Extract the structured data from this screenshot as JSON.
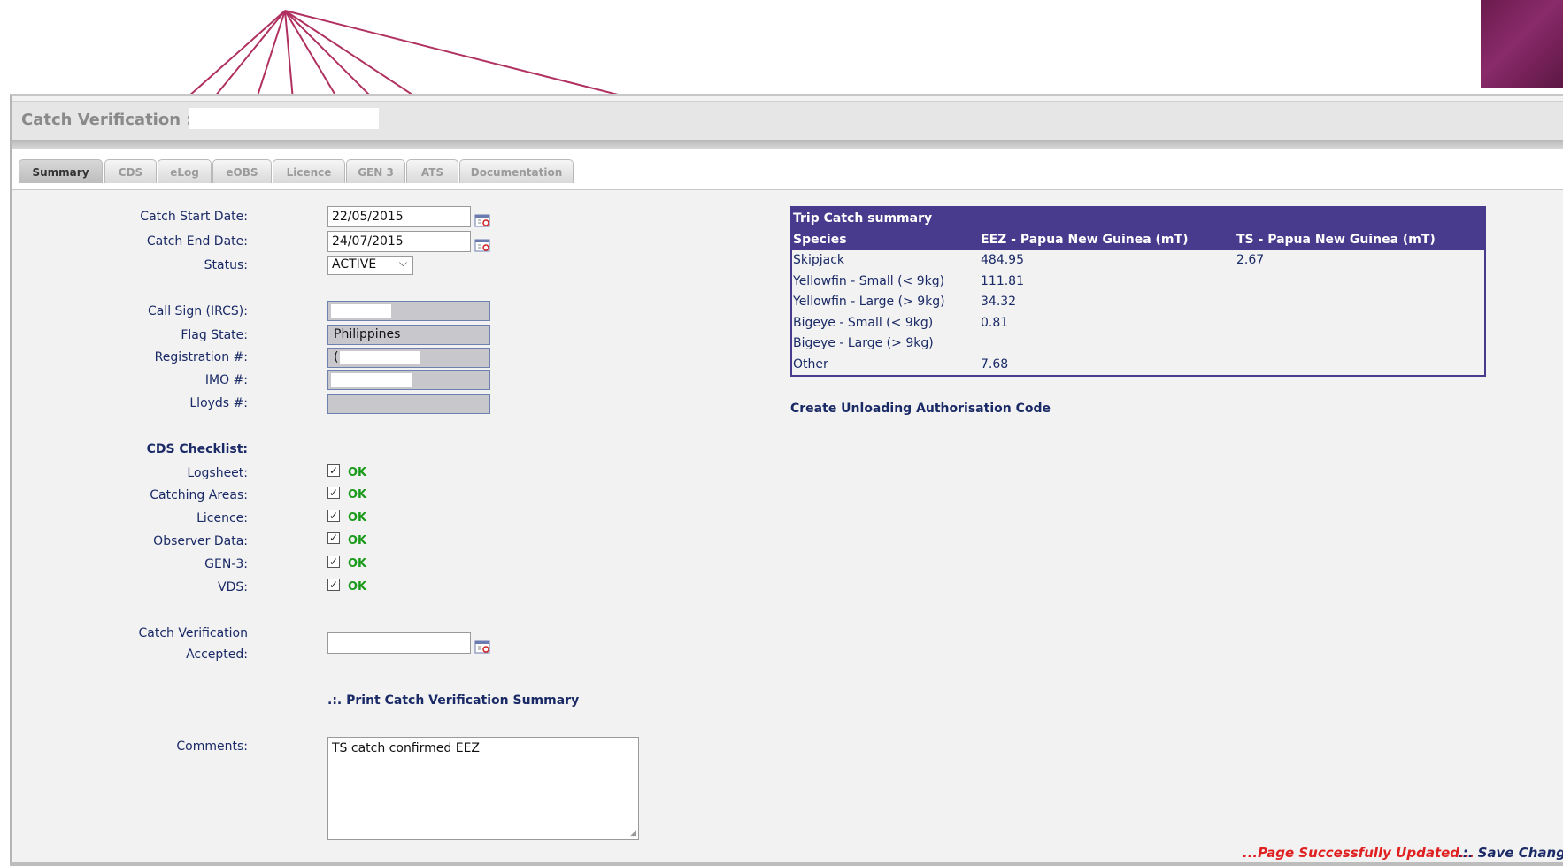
{
  "window": {
    "title": "Catch Verification :"
  },
  "tabs": [
    {
      "label": "Summary",
      "active": true
    },
    {
      "label": "CDS"
    },
    {
      "label": "eLog"
    },
    {
      "label": "eOBS"
    },
    {
      "label": "Licence"
    },
    {
      "label": "GEN 3"
    },
    {
      "label": "ATS"
    },
    {
      "label": "Documentation"
    }
  ],
  "form": {
    "catch_start": {
      "label": "Catch Start Date:",
      "value": "22/05/2015"
    },
    "catch_end": {
      "label": "Catch End Date:",
      "value": "24/07/2015"
    },
    "status": {
      "label": "Status:",
      "value": "ACTIVE"
    },
    "call_sign": {
      "label": "Call Sign (IRCS):",
      "value": ""
    },
    "flag_state": {
      "label": "Flag State:",
      "value": "Philippines"
    },
    "registration": {
      "label": "Registration #:",
      "value": "("
    },
    "imo": {
      "label": "IMO #:",
      "value": ""
    },
    "lloyds": {
      "label": "Lloyds #:",
      "value": ""
    }
  },
  "checklist": {
    "heading": "CDS Checklist:",
    "items": [
      {
        "label": "Logsheet:",
        "checked": true,
        "status": "OK"
      },
      {
        "label": "Catching Areas:",
        "checked": true,
        "status": "OK"
      },
      {
        "label": "Licence:",
        "checked": true,
        "status": "OK"
      },
      {
        "label": "Observer Data:",
        "checked": true,
        "status": "OK"
      },
      {
        "label": "GEN-3:",
        "checked": true,
        "status": "OK"
      },
      {
        "label": "VDS:",
        "checked": true,
        "status": "OK"
      }
    ]
  },
  "verification": {
    "label_line1": "Catch Verification",
    "label_line2": "Accepted:",
    "value": ""
  },
  "print_link": ".:. Print Catch Verification Summary",
  "comments": {
    "label": "Comments:",
    "value": "TS catch confirmed EEZ"
  },
  "trip_summary": {
    "title": "Trip Catch summary",
    "columns": [
      "Species",
      "EEZ - Papua New Guinea (mT)",
      "TS - Papua New Guinea (mT)"
    ],
    "rows": [
      [
        "Skipjack",
        "484.95",
        "2.67"
      ],
      [
        "Yellowfin - Small (< 9kg)",
        "111.81",
        ""
      ],
      [
        "Yellowfin - Large (> 9kg)",
        "34.32",
        ""
      ],
      [
        "Bigeye - Small (< 9kg)",
        "0.81",
        ""
      ],
      [
        "Bigeye - Large (> 9kg)",
        "",
        ""
      ],
      [
        "Other",
        "7.68",
        ""
      ]
    ]
  },
  "unloading_link": "Create Unloading Authorisation Code",
  "status_message": "...Page Successfully Updated...",
  "save_link": ".:. Save Changes",
  "colors": {
    "accent": "#483a8c",
    "ok": "#1a9a1a",
    "error": "#e02020",
    "arrow": "#b03060"
  },
  "icons": [
    "calendar-icon",
    "chevron-down-icon",
    "checkbox-checked-icon",
    "resize-grip-icon"
  ]
}
